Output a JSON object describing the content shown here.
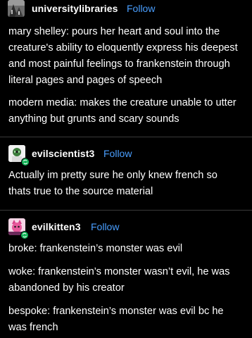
{
  "colors": {
    "background": "#000000",
    "text": "#ffffff",
    "follow": "#4a9fff",
    "divider": "#3a3a3a",
    "reblog_badge": "#16b55a"
  },
  "posts": [
    {
      "username": "universitylibraries",
      "follow_label": "Follow",
      "avatar_icon": "building-photo-icon",
      "paragraphs": [
        [
          "mary shelley: pours her heart and soul into the",
          "creature's ability to eloquently express his deepest",
          "and most painful feelings to frankenstein through",
          "literal pages and pages of speech"
        ],
        [
          "modern media: makes the creature unable to utter",
          "anything but grunts and scary sounds"
        ]
      ]
    },
    {
      "username": "evilscientist3",
      "follow_label": "Follow",
      "avatar_icon": "scientist-avatar-icon",
      "badge_icon": "reblog-icon",
      "paragraphs": [
        [
          "Actually im pretty sure he only knew french so",
          "thats true to the source material"
        ]
      ]
    },
    {
      "username": "evilkitten3",
      "follow_label": "Follow",
      "avatar_icon": "kitten-avatar-icon",
      "badge_icon": "reblog-icon",
      "paragraphs": [
        [
          "broke: frankenstein’s monster was evil"
        ],
        [
          "woke: frankenstein’s monster wasn’t evil, he was",
          "abandoned by his creator"
        ],
        [
          "bespoke: frankenstein’s monster was evil bc he",
          "was french"
        ]
      ]
    }
  ]
}
